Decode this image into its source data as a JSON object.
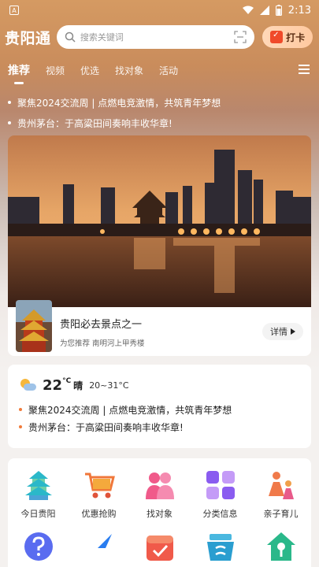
{
  "status_bar": {
    "time": "2:13",
    "notification_letter": "A"
  },
  "header": {
    "logo": "贵阳通",
    "search_placeholder": "搜索关键词",
    "checkin_label": "打卡"
  },
  "tabs": [
    {
      "label": "推荐",
      "active": true
    },
    {
      "label": "视频"
    },
    {
      "label": "优选"
    },
    {
      "label": "找对象"
    },
    {
      "label": "活动"
    }
  ],
  "hero_news": [
    "聚焦2024交流周 | 点燃电竞激情，共筑青年梦想",
    "贵州茅台：于高粱田间奏响丰收华章!"
  ],
  "banner_caption": {
    "title": "贵阳必去景点之一",
    "subtitle": "为您推荐 南明河上甲秀楼",
    "detail_label": "详情"
  },
  "weather": {
    "temperature": "22",
    "unit": "°C",
    "condition": "晴",
    "range": "20~31°C"
  },
  "weather_news": [
    "聚焦2024交流周 | 点燃电竞激情，共筑青年梦想",
    "贵州茅台：于高粱田间奏响丰收华章!"
  ],
  "grid": [
    {
      "label": "今日贵阳",
      "icon": "tower-icon"
    },
    {
      "label": "优惠抢购",
      "icon": "cart-icon"
    },
    {
      "label": "找对象",
      "icon": "couple-icon"
    },
    {
      "label": "分类信息",
      "icon": "category-icon"
    },
    {
      "label": "亲子育儿",
      "icon": "family-icon"
    }
  ],
  "grid_row2_icons": [
    "question-icon",
    "compass-icon",
    "calendar-check-icon",
    "shopping-basket-icon",
    "house-key-icon"
  ],
  "colors": {
    "accent": "#f07a3a",
    "checkin_red": "#f04a2a"
  }
}
